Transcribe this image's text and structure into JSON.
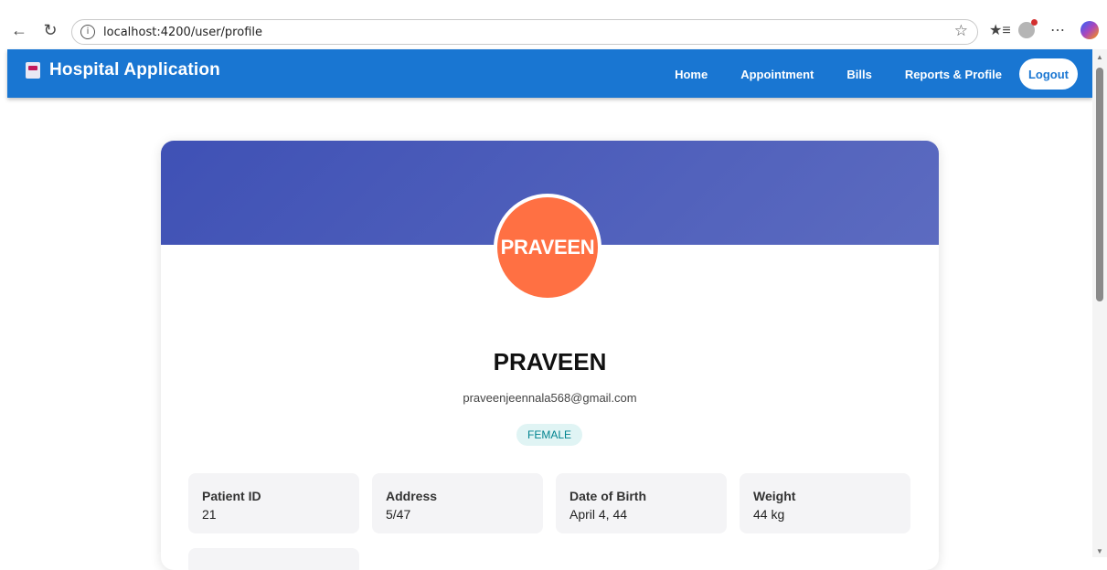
{
  "browser": {
    "url": "localhost:4200/user/profile"
  },
  "header": {
    "title": "Hospital Application",
    "nav": [
      "Home",
      "Appointment",
      "Bills",
      "Reports & Profile"
    ],
    "logout_label": "Logout"
  },
  "profile": {
    "avatar_text": "PRAVEEN",
    "name": "PRAVEEN",
    "email": "praveenjeennala568@gmail.com",
    "gender": "FEMALE",
    "details": [
      {
        "label": "Patient ID",
        "value": "21"
      },
      {
        "label": "Address",
        "value": "5/47"
      },
      {
        "label": "Date of Birth",
        "value": "April 4, 44"
      },
      {
        "label": "Weight",
        "value": "44 kg"
      }
    ]
  },
  "colors": {
    "header": "#1976d2",
    "banner": "#3f51b5",
    "avatar": "#ff7043",
    "gender_badge": "#e0f4f4"
  }
}
